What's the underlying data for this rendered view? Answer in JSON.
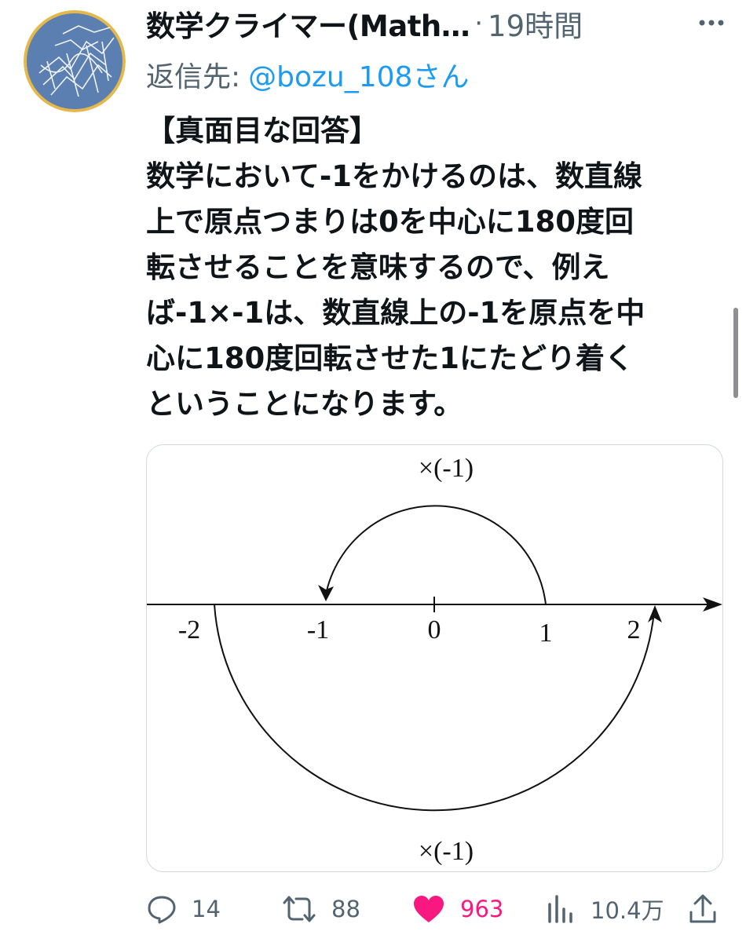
{
  "tweet": {
    "author_name": "数学クライマー(Math…",
    "separator": "·",
    "time": "19時間",
    "reply_prefix": "返信先:",
    "reply_handle": "@bozu_108さん",
    "text_lines": [
      "【真面目な回答】",
      "数学において-1をかけるのは、数直線",
      "上で原点つまりは0を中心に180度回",
      "転させることを意味するので、例え",
      "ば-1×-1は、数直線上の-1を原点を中",
      "心に180度回転させた1にたどり着く",
      "ということになります。"
    ]
  },
  "figure": {
    "top_label": "×(-1)",
    "bottom_label": "×(-1)",
    "ticks": [
      "-2",
      "-1",
      "0",
      "1",
      "2"
    ]
  },
  "actions": {
    "reply": {
      "icon": "reply-icon",
      "count": "14"
    },
    "retweet": {
      "icon": "retweet-icon",
      "count": "88"
    },
    "like": {
      "icon": "heart-icon",
      "count": "963",
      "color": "#f91880"
    },
    "views": {
      "icon": "views-icon",
      "count": "10.4万"
    },
    "share": {
      "icon": "share-icon"
    }
  },
  "colors": {
    "link": "#1d9bf0",
    "muted": "#536471",
    "text": "#0f1419",
    "avatar_ring": "#e4b84a",
    "avatar_fill": "#5b7fb0"
  }
}
